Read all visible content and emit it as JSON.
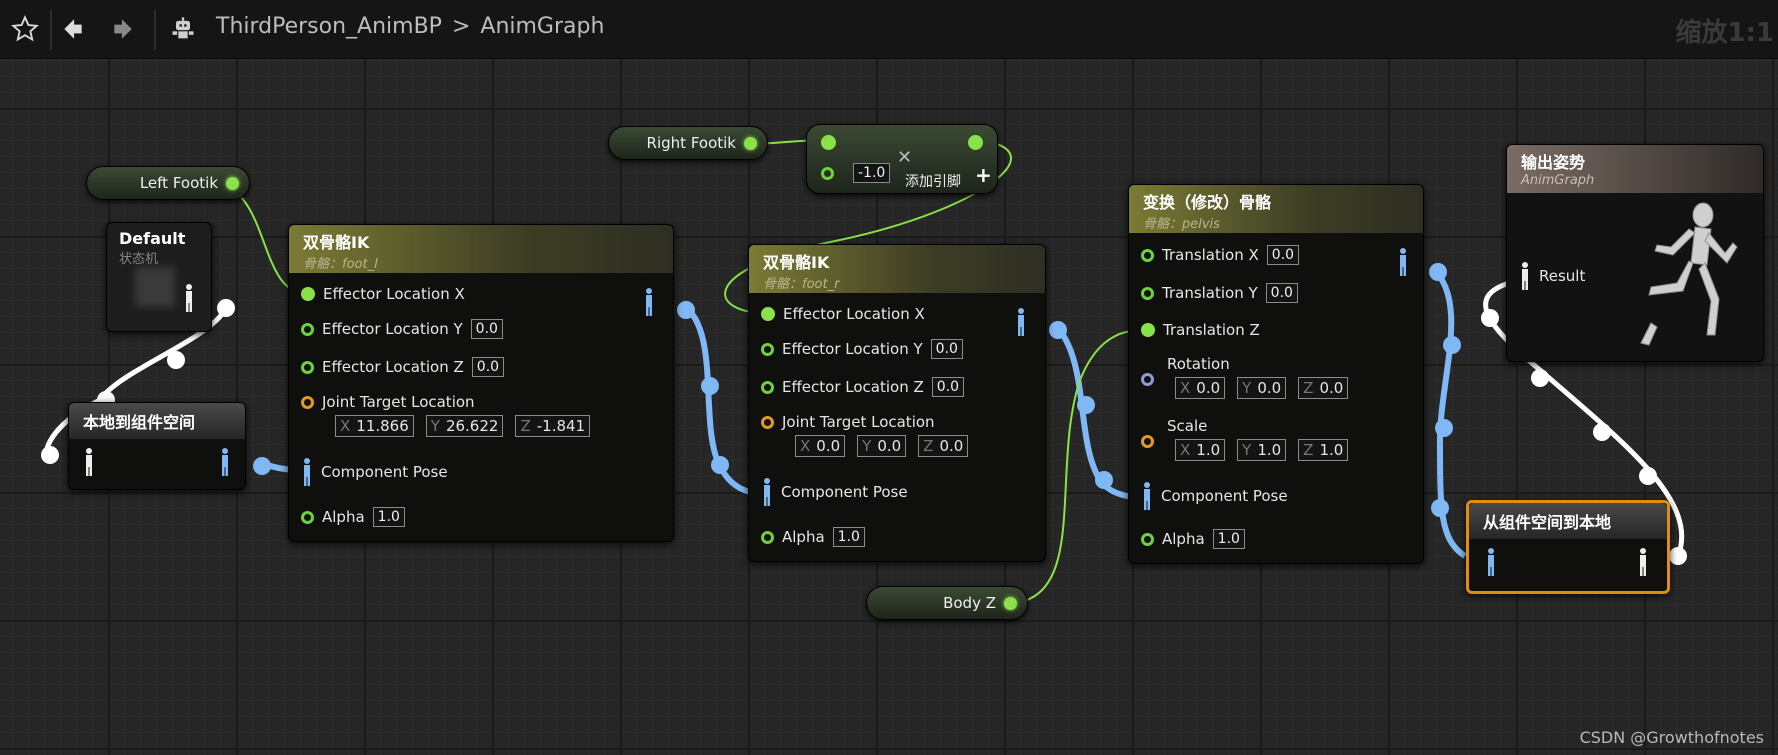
{
  "toolbar": {
    "breadcrumb_blueprint": "ThirdPerson_AnimBP",
    "breadcrumb_separator": ">",
    "breadcrumb_graph": "AnimGraph",
    "zoom": "缩放1:1"
  },
  "variables": {
    "right_footik": "Right Footik",
    "left_footik": "Left Footik",
    "body_z": "Body Z"
  },
  "add_node": {
    "value": "-1.0",
    "add_pin_label": "添加引脚"
  },
  "default_node": {
    "title": "Default",
    "subtitle": "状态机"
  },
  "local_to_component": {
    "title": "本地到组件空间"
  },
  "component_to_local": {
    "title": "从组件空间到本地"
  },
  "ik_left": {
    "title": "双骨骼IK",
    "subtitle": "骨骼：foot_l",
    "effector_x": "Effector Location X",
    "effector_y": "Effector Location Y",
    "effector_y_val": "0.0",
    "effector_z": "Effector Location Z",
    "effector_z_val": "0.0",
    "joint_target": "Joint Target Location",
    "jt_x": "11.866",
    "jt_y": "26.622",
    "jt_z": "-1.841",
    "component_pose": "Component Pose",
    "alpha": "Alpha",
    "alpha_val": "1.0"
  },
  "ik_right": {
    "title": "双骨骼IK",
    "subtitle": "骨骼：foot_r",
    "effector_x": "Effector Location X",
    "effector_y": "Effector Location Y",
    "effector_y_val": "0.0",
    "effector_z": "Effector Location Z",
    "effector_z_val": "0.0",
    "joint_target": "Joint Target Location",
    "jt_x": "0.0",
    "jt_y": "0.0",
    "jt_z": "0.0",
    "component_pose": "Component Pose",
    "alpha": "Alpha",
    "alpha_val": "1.0"
  },
  "transform": {
    "title": "变换（修改）骨骼",
    "subtitle": "骨骼：pelvis",
    "tx": "Translation X",
    "tx_val": "0.0",
    "ty": "Translation Y",
    "ty_val": "0.0",
    "tz": "Translation Z",
    "rotation": "Rotation",
    "rot_x": "0.0",
    "rot_y": "0.0",
    "rot_z": "0.0",
    "scale": "Scale",
    "sc_x": "1.0",
    "sc_y": "1.0",
    "sc_z": "1.0",
    "component_pose": "Component Pose",
    "alpha": "Alpha",
    "alpha_val": "1.0"
  },
  "output_pose": {
    "title": "输出姿势",
    "subtitle": "AnimGraph",
    "result": "Result"
  },
  "axis_labels": {
    "x": "X",
    "y": "Y",
    "z": "Z"
  },
  "watermark": "CSDN @Growthofnotes",
  "colors": {
    "exec_pose_wire": "#7fb8f5",
    "float_wire": "#8ae14a",
    "pose_wire_white": "#ffffff",
    "selected_border": "#e28c11"
  }
}
